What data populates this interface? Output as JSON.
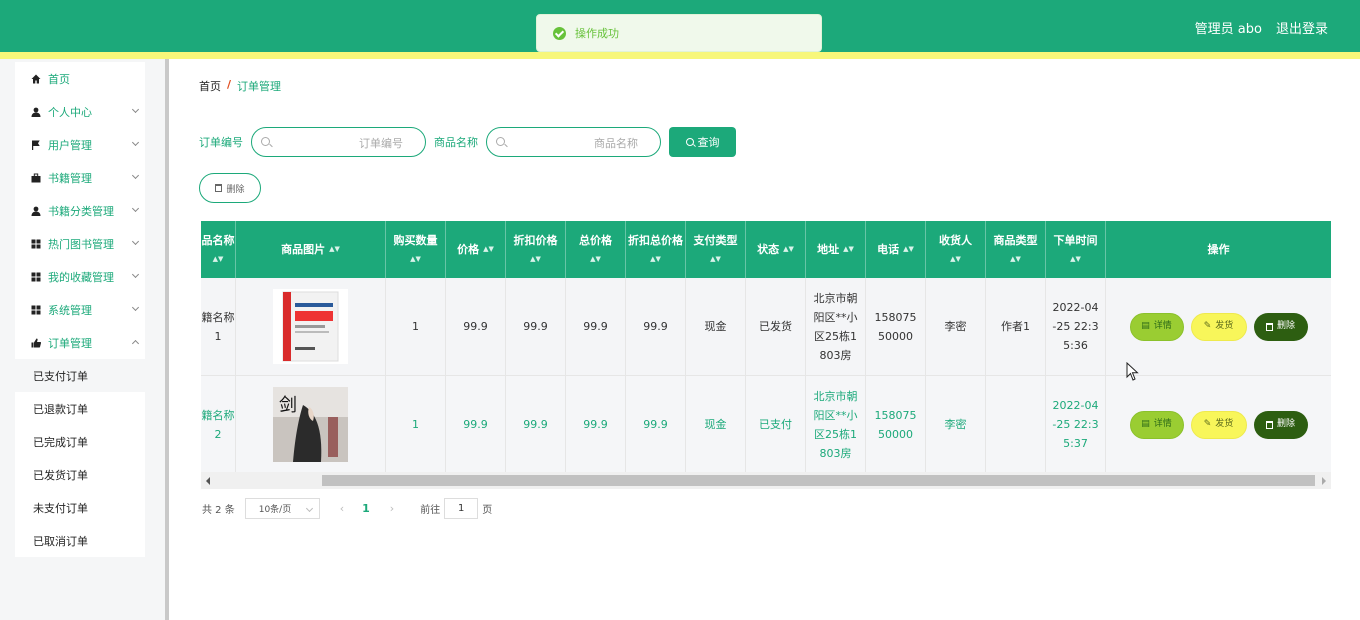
{
  "header": {
    "admin_label": "管理员 abo",
    "logout_label": "退出登录"
  },
  "toast": {
    "message": "操作成功"
  },
  "sidebar": {
    "items": [
      {
        "label": "首页",
        "icon": "home-icon"
      },
      {
        "label": "个人中心",
        "icon": "user-icon"
      },
      {
        "label": "用户管理",
        "icon": "flag-icon"
      },
      {
        "label": "书籍管理",
        "icon": "briefcase-icon"
      },
      {
        "label": "书籍分类管理",
        "icon": "user-icon"
      },
      {
        "label": "热门图书管理",
        "icon": "grid-icon"
      },
      {
        "label": "我的收藏管理",
        "icon": "grid-icon"
      },
      {
        "label": "系统管理",
        "icon": "grid-icon"
      },
      {
        "label": "订单管理",
        "icon": "thumb-icon"
      }
    ],
    "sub_items": [
      "已支付订单",
      "已退款订单",
      "已完成订单",
      "已发货订单",
      "未支付订单",
      "已取消订单"
    ]
  },
  "breadcrumb": {
    "home": "首页",
    "separator": "/",
    "current": "订单管理"
  },
  "search": {
    "order_no_label": "订单编号",
    "order_no_placeholder": "订单编号",
    "product_label": "商品名称",
    "product_placeholder": "商品名称",
    "query_button": "查询"
  },
  "delete_button": "删除",
  "table": {
    "headers": [
      "品名称",
      "商品图片",
      "购买数量",
      "价格",
      "折扣价格",
      "总价格",
      "折扣总价格",
      "支付类型",
      "状态",
      "地址",
      "电话",
      "收货人",
      "商品类型",
      "下单时间",
      "操作"
    ],
    "rows": [
      {
        "name": "籍名称1",
        "qty": "1",
        "price": "99.9",
        "discount": "99.9",
        "total": "99.9",
        "discount_total": "99.9",
        "pay_type": "现金",
        "status": "已发货",
        "address": "北京市朝阳区**小区25栋1803房",
        "phone": "15807550000",
        "receiver": "李密",
        "type": "作者1",
        "time": "2022-04-25 22:35:36"
      },
      {
        "name": "籍名称2",
        "qty": "1",
        "price": "99.9",
        "discount": "99.9",
        "total": "99.9",
        "discount_total": "99.9",
        "pay_type": "现金",
        "status": "已支付",
        "address": "北京市朝阳区**小区25栋1803房",
        "phone": "15807550000",
        "receiver": "李密",
        "type": "",
        "time": "2022-04-25 22:35:37"
      }
    ],
    "actions": {
      "detail": "详情",
      "ship": "发货",
      "delete": "删除"
    }
  },
  "pager": {
    "total": "共 2 条",
    "page_size": "10条/页",
    "current": "1",
    "goto_label": "前往",
    "goto_value": "1",
    "page_unit": "页"
  },
  "colors": {
    "primary": "#1ca97a",
    "stripe": "#f7f77a"
  }
}
